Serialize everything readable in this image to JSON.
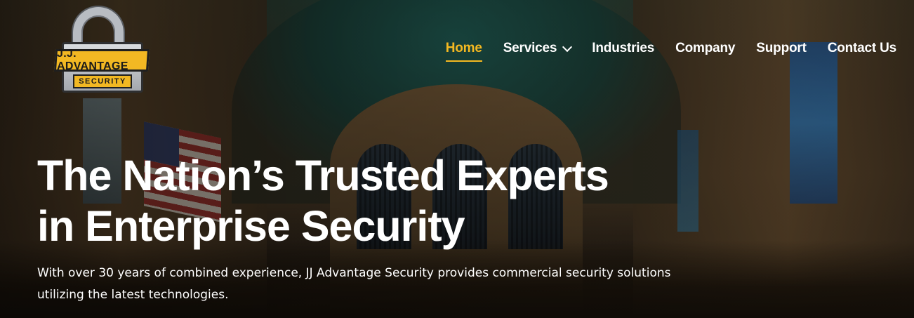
{
  "logo": {
    "name": "J.J. ADVANTAGE",
    "sub": "SECURITY",
    "icon": "padlock-icon"
  },
  "nav": {
    "items": [
      {
        "label": "Home",
        "active": true
      },
      {
        "label": "Services",
        "has_dropdown": true,
        "icon": "chevron-down-icon"
      },
      {
        "label": "Industries"
      },
      {
        "label": "Company"
      },
      {
        "label": "Support"
      },
      {
        "label": "Contact Us"
      }
    ]
  },
  "hero": {
    "headline_line1": "The Nation’s Trusted Experts",
    "headline_line2": "in Enterprise Security",
    "subtext": "With over 30 years of combined experience, JJ Advantage Security provides commercial security solutions utilizing the latest technologies."
  },
  "colors": {
    "accent": "#f5b921",
    "text": "#ffffff",
    "logo_yellow": "#f2b823"
  }
}
